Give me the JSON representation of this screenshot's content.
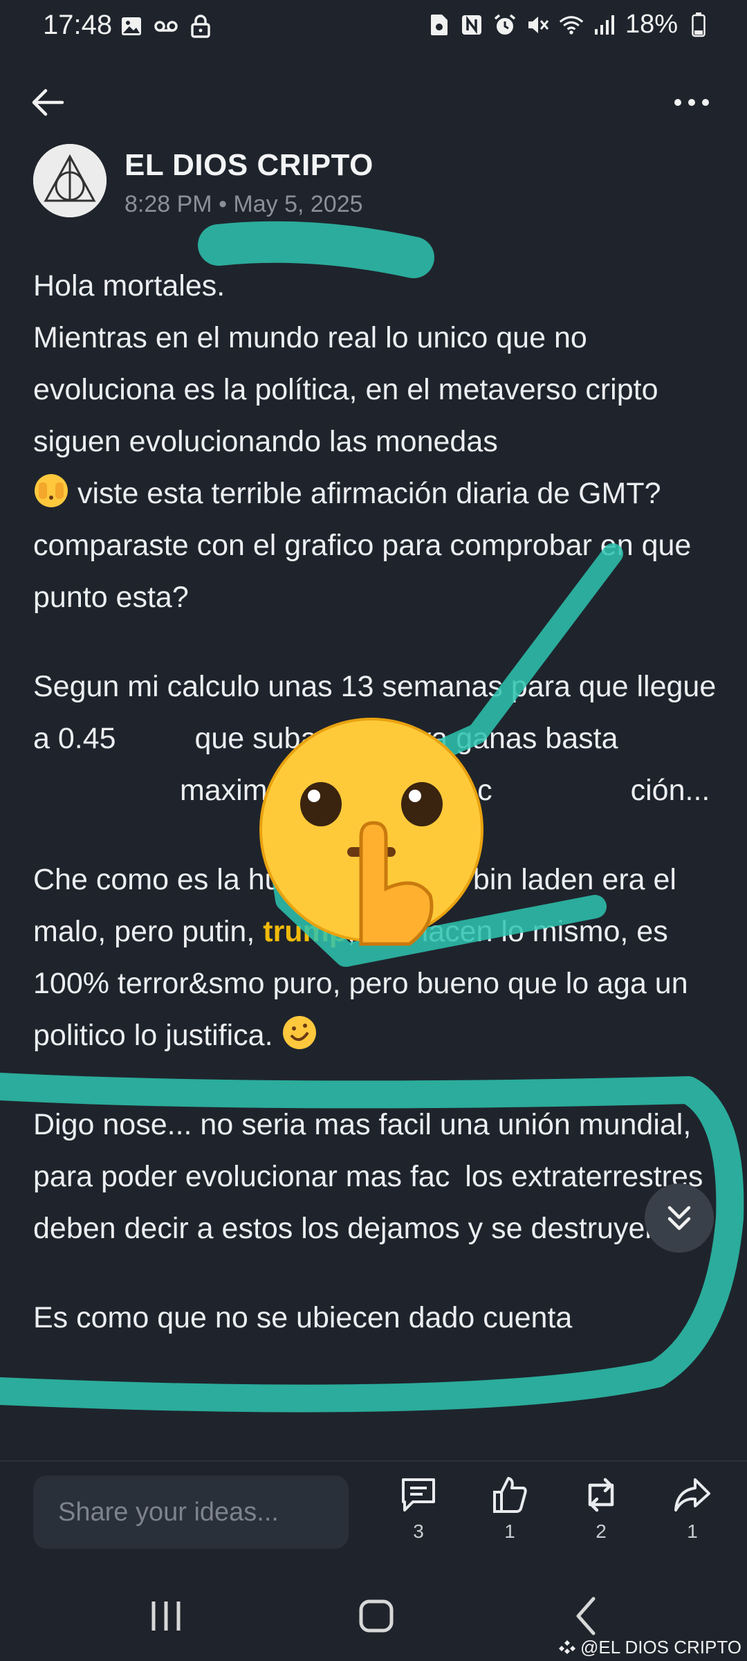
{
  "status_bar": {
    "time": "17:48",
    "battery": "18%",
    "left_icons": [
      "image-icon",
      "voicemail-icon",
      "lock-icon"
    ],
    "right_icons": [
      "nfc-card-icon",
      "nfc-icon",
      "alarm-icon",
      "mute-icon",
      "wifi-icon",
      "signal-icon",
      "battery-icon"
    ]
  },
  "post": {
    "author": "EL DIOS CRIPTO",
    "timestamp": "8:28 PM • May 5, 2025",
    "paragraphs": {
      "p1": "Hola mortales.\nMientras en el mundo real lo unico que no evoluciona es la política, en el metaverso cripto siguen evolucionando las monedas",
      "p1b": " viste esta terrible afirmación diaria de GMT? comparaste con el grafico para comprobar en que punto esta?",
      "p2": "Segun mi calculo unas 13 semanas para que llegue a 0.45 ",
      "p2b": " que suba a 0.23 ya ganas basta",
      "p2c": " maximo historico 4.60 c",
      "p2d": "ción...",
      "p3a": "Che como es la hu",
      "p3b": "dad no? bin laden era el malo, pero putin, ",
      "p3_mention": "trump",
      "p3c": ", etc hacen lo mismo, es 100% terror&smo puro, pero bueno que lo aga un politico lo justifica. ",
      "p4": "Digo nose... no seria mas facil una unión mundial, para poder evolucionar mas fac",
      "p4b": " los extraterrestres deben decir a estos los dejamos y se destruyen. ",
      "p5": "Es como que no se ubiecen dado cuenta"
    }
  },
  "composer": {
    "placeholder": "Share your ideas..."
  },
  "actions": {
    "comments": "3",
    "likes": "1",
    "reposts": "2",
    "shares": "1"
  },
  "watermark": "@EL DIOS CRIPTO",
  "colors": {
    "background": "#1f242c",
    "mention": "#f0b90b",
    "highlighter": "#2ec4b0"
  }
}
